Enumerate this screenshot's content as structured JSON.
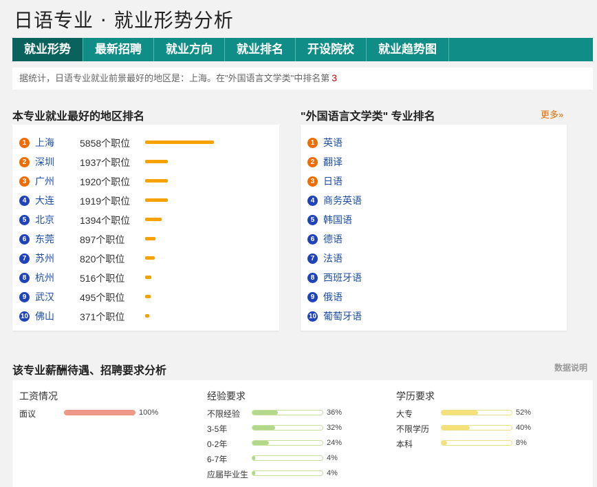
{
  "title": "日语专业 · 就业形势分析",
  "tabs": [
    {
      "label": "就业形势"
    },
    {
      "label": "最新招聘"
    },
    {
      "label": "就业方向"
    },
    {
      "label": "就业排名"
    },
    {
      "label": "开设院校"
    },
    {
      "label": "就业趋势图"
    }
  ],
  "notice": {
    "text": "据统计，日语专业就业前景最好的地区是：上海。在\"外国语言文学类\"中排名第",
    "rank": "3"
  },
  "regions": {
    "heading": "本专业就业最好的地区排名",
    "items": [
      {
        "num": "1",
        "name": "上海",
        "count": "5858个职位",
        "value": 5858
      },
      {
        "num": "2",
        "name": "深圳",
        "count": "1937个职位",
        "value": 1937
      },
      {
        "num": "3",
        "name": "广州",
        "count": "1920个职位",
        "value": 1920
      },
      {
        "num": "4",
        "name": "大连",
        "count": "1919个职位",
        "value": 1919
      },
      {
        "num": "5",
        "name": "北京",
        "count": "1394个职位",
        "value": 1394
      },
      {
        "num": "6",
        "name": "东莞",
        "count": "897个职位",
        "value": 897
      },
      {
        "num": "7",
        "name": "苏州",
        "count": "820个职位",
        "value": 820
      },
      {
        "num": "8",
        "name": "杭州",
        "count": "516个职位",
        "value": 516
      },
      {
        "num": "9",
        "name": "武汉",
        "count": "495个职位",
        "value": 495
      },
      {
        "num": "10",
        "name": "佛山",
        "count": "371个职位",
        "value": 371
      }
    ]
  },
  "majors": {
    "heading": "\"外国语言文学类\" 专业排名",
    "more": "更多»",
    "items": [
      {
        "num": "1",
        "name": "英语"
      },
      {
        "num": "2",
        "name": "翻译"
      },
      {
        "num": "3",
        "name": "日语"
      },
      {
        "num": "4",
        "name": "商务英语"
      },
      {
        "num": "5",
        "name": "韩国语"
      },
      {
        "num": "6",
        "name": "德语"
      },
      {
        "num": "7",
        "name": "法语"
      },
      {
        "num": "8",
        "name": "西班牙语"
      },
      {
        "num": "9",
        "name": "俄语"
      },
      {
        "num": "10",
        "name": "葡萄牙语"
      }
    ]
  },
  "analysis": {
    "heading": "该专业薪酬待遇、招聘要求分析",
    "data_note": "数据说明",
    "colors": {
      "salary": "#ef9a86",
      "experience": "#b3d88a",
      "education": "#f5e07a"
    },
    "salary": {
      "heading": "工资情况",
      "items": [
        {
          "label": "面议",
          "pct": "100%",
          "value": 100
        }
      ]
    },
    "experience": {
      "heading": "经验要求",
      "items": [
        {
          "label": "不限经验",
          "pct": "36%",
          "value": 36
        },
        {
          "label": "3-5年",
          "pct": "32%",
          "value": 32
        },
        {
          "label": "0-2年",
          "pct": "24%",
          "value": 24
        },
        {
          "label": "6-7年",
          "pct": "4%",
          "value": 4
        },
        {
          "label": "应届毕业生",
          "pct": "4%",
          "value": 4
        }
      ]
    },
    "education": {
      "heading": "学历要求",
      "items": [
        {
          "label": "大专",
          "pct": "52%",
          "value": 52
        },
        {
          "label": "不限学历",
          "pct": "40%",
          "value": 40
        },
        {
          "label": "本科",
          "pct": "8%",
          "value": 8
        }
      ]
    }
  }
}
